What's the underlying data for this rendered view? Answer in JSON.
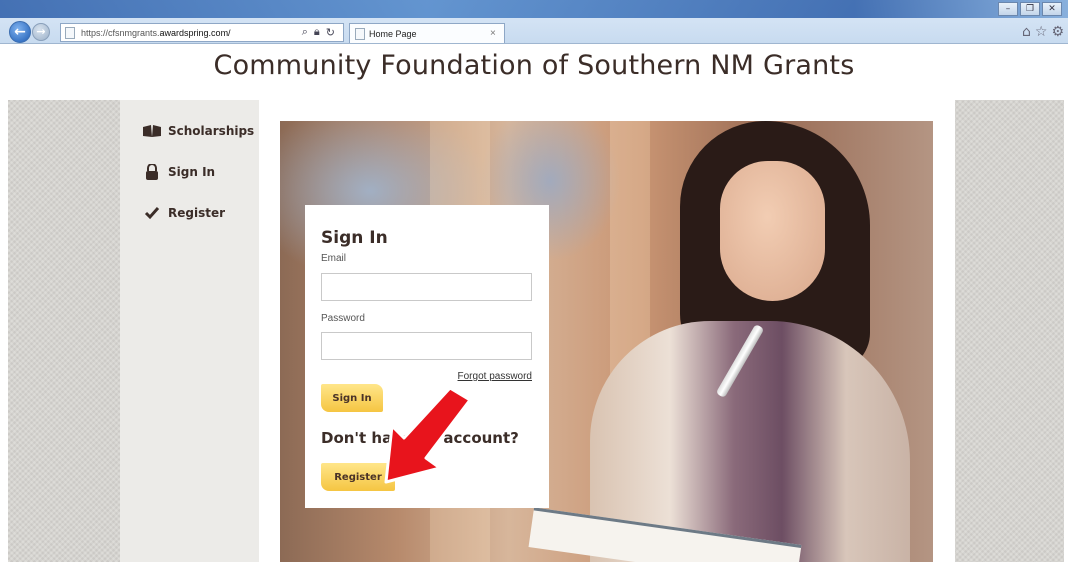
{
  "browser": {
    "url_prefix": "https://cfsnmgrants.",
    "url_domain": "awardspring.com/",
    "tab_title": "Home Page",
    "back_icon": "back-arrow-icon",
    "forward_icon": "forward-arrow-icon"
  },
  "site": {
    "title": "Community Foundation of Southern NM Grants"
  },
  "sidebar": {
    "items": [
      {
        "label": "Scholarships",
        "icon": "book-icon"
      },
      {
        "label": "Sign In",
        "icon": "lock-icon"
      },
      {
        "label": "Register",
        "icon": "checkmark-icon"
      }
    ]
  },
  "signin": {
    "heading": "Sign In",
    "email_label": "Email",
    "email_value": "",
    "password_label": "Password",
    "password_value": "",
    "forgot_label": "Forgot password",
    "signin_button": "Sign In",
    "no_account_text": "Don't have an account?",
    "register_button": "Register"
  },
  "colors": {
    "brand_text": "#3b2d28",
    "button_yellow": "#f5c542",
    "annotation_arrow": "#e8141c"
  }
}
